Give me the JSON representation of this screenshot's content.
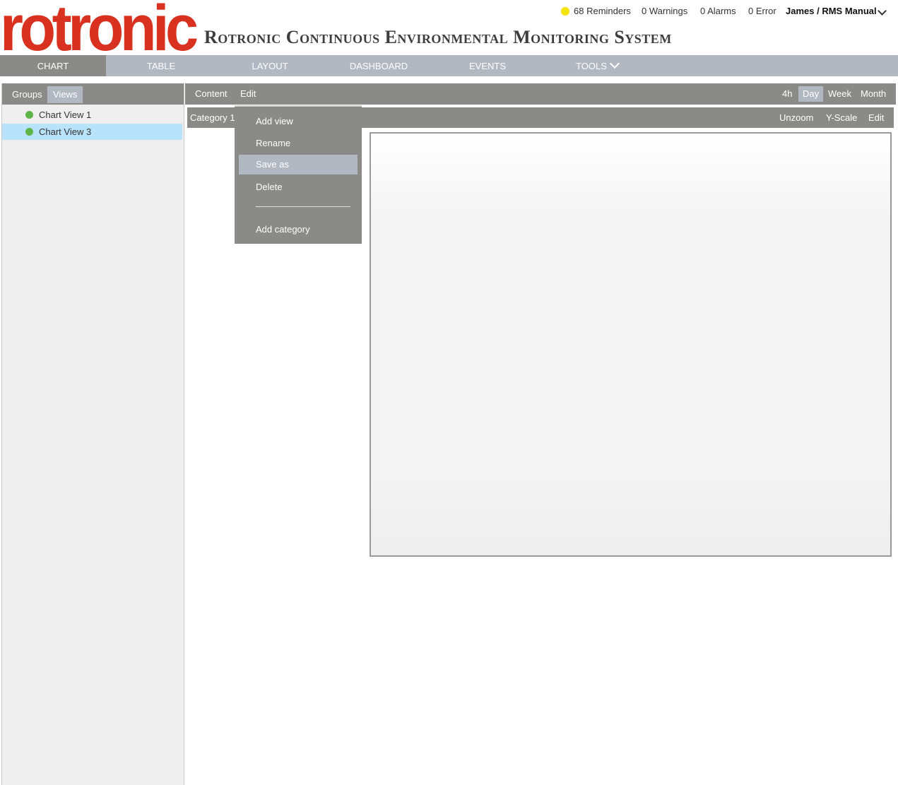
{
  "header": {
    "logo_text": "rotronic",
    "app_title": "Rotronic Continuous Environmental Monitoring System",
    "status": {
      "reminders": "68 Reminders",
      "warnings": "0 Warnings",
      "alarms": "0 Alarms",
      "errors": "0 Error",
      "user": "James / RMS Manual"
    },
    "colors": {
      "brand": "#d9311f",
      "reminder_dot": "#f6e20c"
    }
  },
  "nav": {
    "tabs": [
      {
        "label": "Chart",
        "active": true
      },
      {
        "label": "Table"
      },
      {
        "label": "Layout"
      },
      {
        "label": "Dashboard"
      },
      {
        "label": "Events"
      },
      {
        "label": "Tools"
      }
    ]
  },
  "sidebar": {
    "tabs": [
      {
        "label": "Groups"
      },
      {
        "label": "Views",
        "active": true
      }
    ],
    "items": [
      {
        "label": "Chart View 1",
        "status_color": "#5fb447"
      },
      {
        "label": "Chart View 3",
        "status_color": "#5fb447",
        "selected": true
      }
    ]
  },
  "toolbar": {
    "content_label": "Content",
    "edit_label": "Edit",
    "ranges": [
      {
        "label": "4h"
      },
      {
        "label": "Day",
        "active": true
      },
      {
        "label": "Week"
      },
      {
        "label": "Month"
      }
    ]
  },
  "category_bar": {
    "name": "Category 1",
    "unzoom": "Unzoom",
    "yscale": "Y-Scale",
    "edit": "Edit"
  },
  "edit_menu": {
    "items": [
      {
        "label": "Add view"
      },
      {
        "label": "Rename"
      },
      {
        "label": "Save as",
        "hover": true
      },
      {
        "label": "Delete"
      },
      {
        "label": "Add category"
      }
    ]
  }
}
